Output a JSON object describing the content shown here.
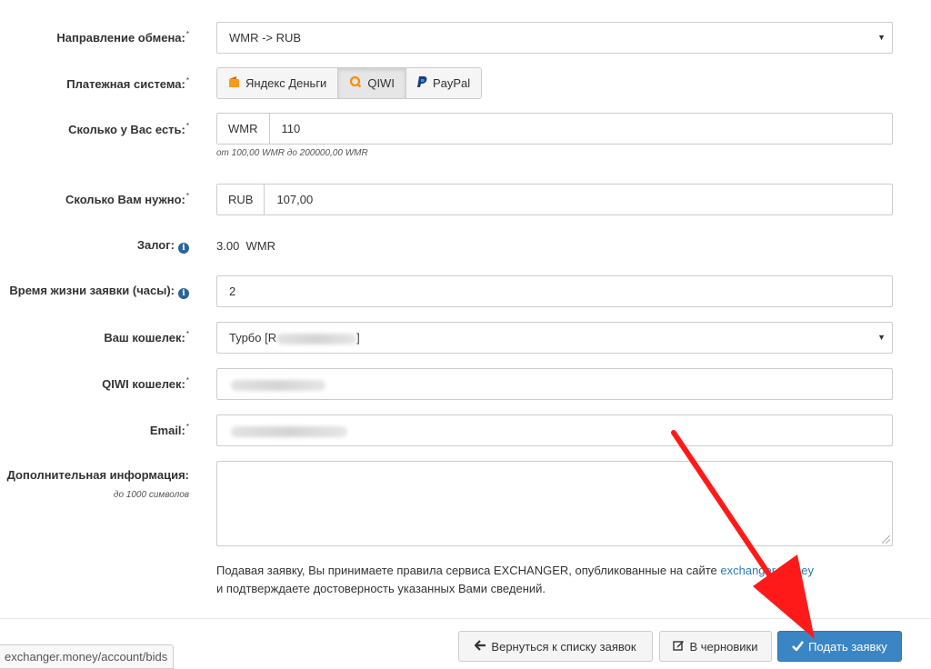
{
  "form": {
    "direction": {
      "label": "Направление обмена:",
      "req": "*",
      "value": "WMR -> RUB"
    },
    "payment_system": {
      "label": "Платежная система:",
      "req": "*",
      "options": [
        {
          "label": "Яндекс Деньги",
          "icon": "yandex-money-icon"
        },
        {
          "label": "QIWI",
          "icon": "qiwi-icon",
          "selected": true
        },
        {
          "label": "PayPal",
          "icon": "paypal-icon"
        }
      ]
    },
    "have": {
      "label": "Сколько у Вас есть:",
      "req": "*",
      "currency": "WMR",
      "value": "110",
      "help": "от 100,00 WMR до 200000,00 WMR"
    },
    "need": {
      "label": "Сколько Вам нужно:",
      "req": "*",
      "currency": "RUB",
      "value": "107,00"
    },
    "deposit": {
      "label": "Залог:",
      "value": "3.00  WMR"
    },
    "lifetime": {
      "label": "Время жизни заявки (часы):",
      "value": "2"
    },
    "wallet": {
      "label": "Ваш кошелек:",
      "req": "*",
      "value_prefix": "Турбо [R",
      "value_suffix": "]"
    },
    "qiwi_wallet": {
      "label": "QIWI кошелек:",
      "req": "*"
    },
    "email": {
      "label": "Email:",
      "req": "*"
    },
    "extra": {
      "label": "Дополнительная информация:",
      "hint": "до 1000 символов"
    }
  },
  "terms": {
    "line1_before": "Подавая заявку, Вы принимаете правила сервиса EXCHANGER, опубликованные на сайте ",
    "link": "exchanger.money",
    "line2": "и подтверждаете достоверность указанных Вами сведений."
  },
  "buttons": {
    "back": {
      "label": "Вернуться к списку заявок",
      "icon": "arrow-left-icon"
    },
    "draft": {
      "label": "В черновики",
      "icon": "edit-icon"
    },
    "submit": {
      "label": "Подать заявку",
      "icon": "check-icon"
    }
  },
  "status_bar": {
    "url": "exchanger.money/account/bids"
  },
  "colors": {
    "primary": "#3a86c5",
    "link": "#2a7ab7",
    "info_icon": "#2a6496",
    "annotation_arrow": "#ff1a1a"
  }
}
